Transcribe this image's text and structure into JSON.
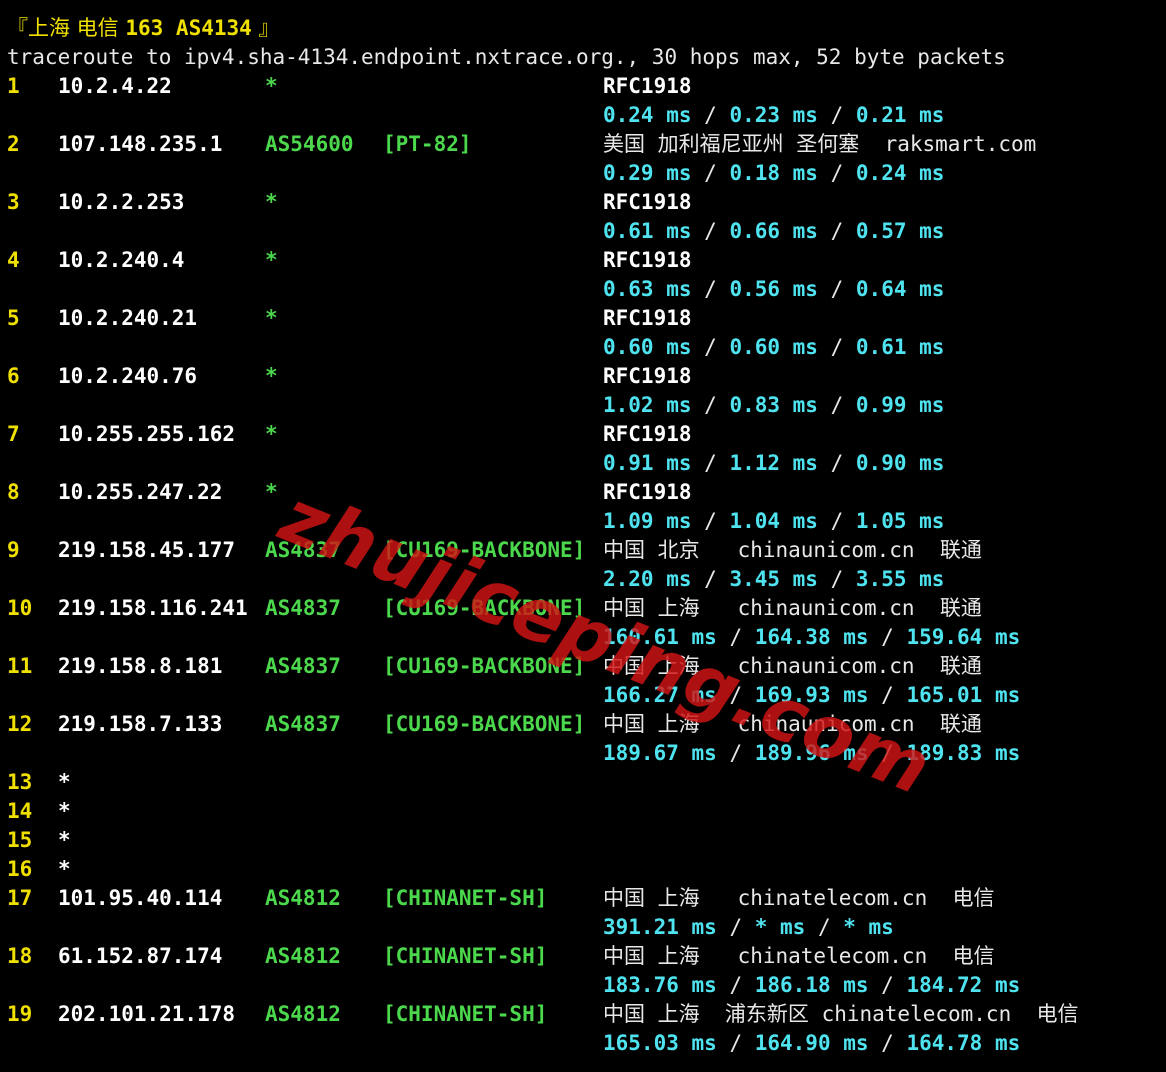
{
  "title": {
    "cn": "『上海 电信 ",
    "bold": "163 AS4134",
    "end": " 』"
  },
  "header": "traceroute to ipv4.sha-4134.endpoint.nxtrace.org., 30 hops max, 52 byte packets",
  "hops": [
    {
      "n": "1",
      "ip": "10.2.4.22",
      "asn": "*",
      "tag": "",
      "geo": "RFC1918",
      "geo_bold": true,
      "rtt": [
        "0.24 ms",
        "0.23 ms",
        "0.21 ms"
      ]
    },
    {
      "n": "2",
      "ip": "107.148.235.1",
      "asn": "AS54600",
      "tag": "[PT-82]",
      "geo": "美国 加利福尼亚州 圣何塞  raksmart.com",
      "geo_bold": false,
      "rtt": [
        "0.29 ms",
        "0.18 ms",
        "0.24 ms"
      ]
    },
    {
      "n": "3",
      "ip": "10.2.2.253",
      "asn": "*",
      "tag": "",
      "geo": "RFC1918",
      "geo_bold": true,
      "rtt": [
        "0.61 ms",
        "0.66 ms",
        "0.57 ms"
      ]
    },
    {
      "n": "4",
      "ip": "10.2.240.4",
      "asn": "*",
      "tag": "",
      "geo": "RFC1918",
      "geo_bold": true,
      "rtt": [
        "0.63 ms",
        "0.56 ms",
        "0.64 ms"
      ]
    },
    {
      "n": "5",
      "ip": "10.2.240.21",
      "asn": "*",
      "tag": "",
      "geo": "RFC1918",
      "geo_bold": true,
      "rtt": [
        "0.60 ms",
        "0.60 ms",
        "0.61 ms"
      ]
    },
    {
      "n": "6",
      "ip": "10.2.240.76",
      "asn": "*",
      "tag": "",
      "geo": "RFC1918",
      "geo_bold": true,
      "rtt": [
        "1.02 ms",
        "0.83 ms",
        "0.99 ms"
      ]
    },
    {
      "n": "7",
      "ip": "10.255.255.162",
      "asn": "*",
      "tag": "",
      "geo": "RFC1918",
      "geo_bold": true,
      "rtt": [
        "0.91 ms",
        "1.12 ms",
        "0.90 ms"
      ]
    },
    {
      "n": "8",
      "ip": "10.255.247.22",
      "asn": "*",
      "tag": "",
      "geo": "RFC1918",
      "geo_bold": true,
      "rtt": [
        "1.09 ms",
        "1.04 ms",
        "1.05 ms"
      ]
    },
    {
      "n": "9",
      "ip": "219.158.45.177",
      "asn": "AS4837",
      "tag": "[CU169-BACKBONE]",
      "geo": "中国 北京   chinaunicom.cn  联通",
      "geo_bold": false,
      "rtt": [
        "2.20 ms",
        "3.45 ms",
        "3.55 ms"
      ]
    },
    {
      "n": "10",
      "ip": "219.158.116.241",
      "asn": "AS4837",
      "tag": "[CU169-BACKBONE]",
      "geo": "中国 上海   chinaunicom.cn  联通",
      "geo_bold": false,
      "rtt": [
        "160.61 ms",
        "164.38 ms",
        "159.64 ms"
      ]
    },
    {
      "n": "11",
      "ip": "219.158.8.181",
      "asn": "AS4837",
      "tag": "[CU169-BACKBONE]",
      "geo": "中国 上海   chinaunicom.cn  联通",
      "geo_bold": false,
      "rtt": [
        "166.27 ms",
        "169.93 ms",
        "165.01 ms"
      ]
    },
    {
      "n": "12",
      "ip": "219.158.7.133",
      "asn": "AS4837",
      "tag": "[CU169-BACKBONE]",
      "geo": "中国 上海   chinaunicom.cn  联通",
      "geo_bold": false,
      "rtt": [
        "189.67 ms",
        "189.96 ms",
        "189.83 ms"
      ]
    },
    {
      "n": "13",
      "ip": "*"
    },
    {
      "n": "14",
      "ip": "*"
    },
    {
      "n": "15",
      "ip": "*"
    },
    {
      "n": "16",
      "ip": "*"
    },
    {
      "n": "17",
      "ip": "101.95.40.114",
      "asn": "AS4812",
      "tag": "[CHINANET-SH]",
      "geo": "中国 上海   chinatelecom.cn  电信",
      "geo_bold": false,
      "rtt": [
        "391.21 ms",
        "* ms",
        "* ms"
      ]
    },
    {
      "n": "18",
      "ip": "61.152.87.174",
      "asn": "AS4812",
      "tag": "[CHINANET-SH]",
      "geo": "中国 上海   chinatelecom.cn  电信",
      "geo_bold": false,
      "rtt": [
        "183.76 ms",
        "186.18 ms",
        "184.72 ms"
      ]
    },
    {
      "n": "19",
      "ip": "202.101.21.178",
      "asn": "AS4812",
      "tag": "[CHINANET-SH]",
      "geo": "中国 上海  浦东新区 chinatelecom.cn  电信",
      "geo_bold": false,
      "rtt": [
        "165.03 ms",
        "164.90 ms",
        "164.78 ms"
      ]
    }
  ],
  "watermark": "zhujiceping.com",
  "colors": {
    "background": "#000000",
    "hop": "#f0e000",
    "ip": "#ffffff",
    "asn": "#4cd84c",
    "rtt": "#4fe3f0",
    "watermark": "#d21414"
  }
}
